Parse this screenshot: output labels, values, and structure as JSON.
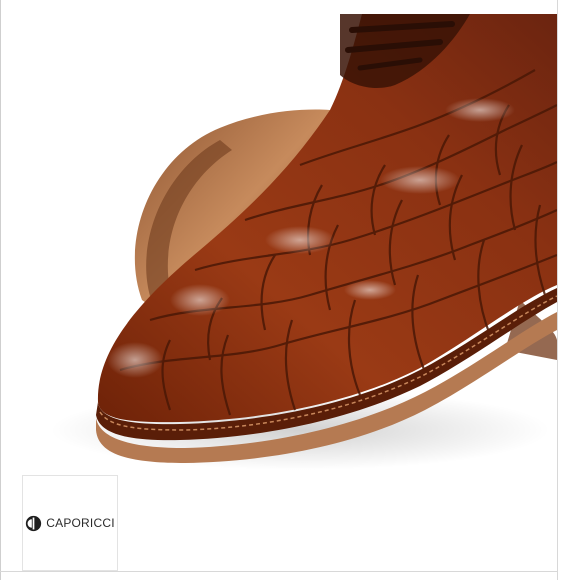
{
  "image": {
    "subject": "brown-alligator-leather-shoe-closeup",
    "background_color": "#ffffff",
    "leather_color": "#8e3414",
    "sole_color": "#a86b45"
  },
  "logo": {
    "brand": "CAPORICCI",
    "icon": "caporicci-mark-icon"
  }
}
